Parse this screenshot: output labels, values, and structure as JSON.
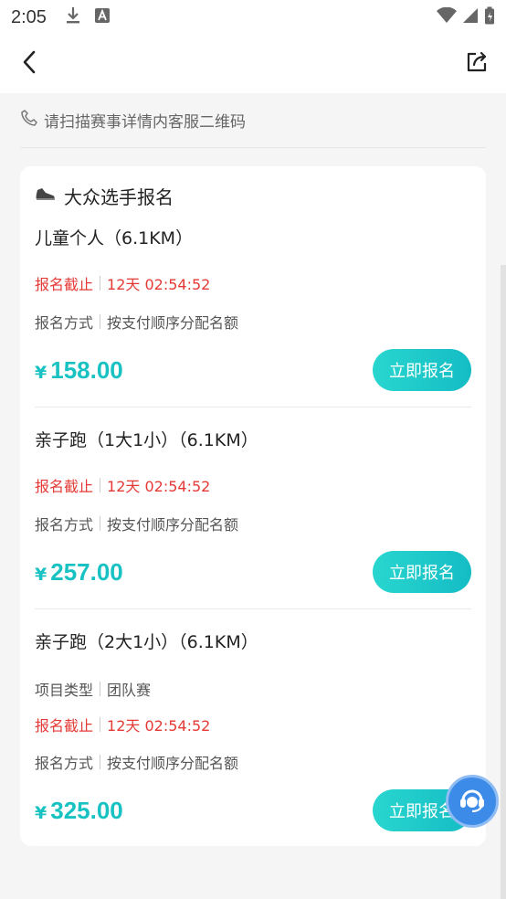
{
  "status_bar": {
    "time": "2:05"
  },
  "nav": {
    "back_icon": "chevron-left-icon",
    "share_icon": "share-icon"
  },
  "notice": {
    "icon": "phone-icon",
    "text": "请扫描赛事详情内客服二维码"
  },
  "card": {
    "icon": "shoe-icon",
    "title": "大众选手报名",
    "items": [
      {
        "name": "儿童个人（6.1KM）",
        "deadline_label": "报名截止",
        "deadline_value": "12天 02:54:52",
        "method_label": "报名方式",
        "method_value": "按支付顺序分配名额",
        "currency": "¥",
        "price": "158.00",
        "button": "立即报名"
      },
      {
        "name": "亲子跑（1大1小）（6.1KM）",
        "deadline_label": "报名截止",
        "deadline_value": "12天 02:54:52",
        "method_label": "报名方式",
        "method_value": "按支付顺序分配名额",
        "currency": "¥",
        "price": "257.00",
        "button": "立即报名"
      },
      {
        "name": "亲子跑（2大1小）（6.1KM）",
        "type_label": "项目类型",
        "type_value": "团队赛",
        "deadline_label": "报名截止",
        "deadline_value": "12天 02:54:52",
        "method_label": "报名方式",
        "method_value": "按支付顺序分配名额",
        "currency": "¥",
        "price": "325.00",
        "button": "立即报名"
      }
    ]
  },
  "colors": {
    "accent": "#19c2c2",
    "deadline": "#e53935",
    "service_button": "#3d8be8"
  },
  "floating_button": {
    "icon": "customer-service-icon"
  }
}
